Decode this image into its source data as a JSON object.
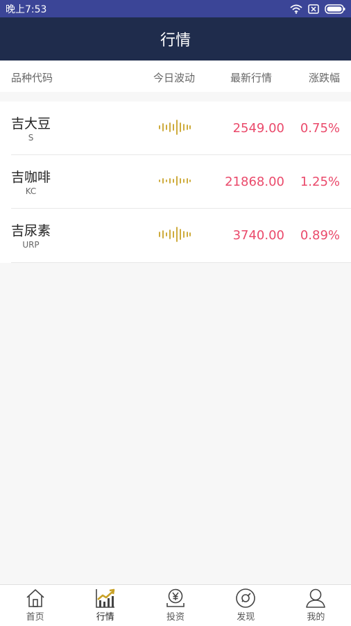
{
  "status_bar": {
    "time": "晚上7:53",
    "icons": [
      "wifi-icon",
      "sim-icon",
      "battery-icon"
    ]
  },
  "header": {
    "title": "行情"
  },
  "columns": {
    "code": "品种代码",
    "wave": "今日波动",
    "price": "最新行情",
    "change": "涨跌幅"
  },
  "rows": [
    {
      "name": "吉大豆",
      "code": "S",
      "price": "2549.00",
      "change": "0.75%"
    },
    {
      "name": "吉咖啡",
      "code": "KC",
      "price": "21868.00",
      "change": "1.25%"
    },
    {
      "name": "吉尿素",
      "code": "URP",
      "price": "3740.00",
      "change": "0.89%"
    }
  ],
  "tabs": [
    {
      "label": "首页",
      "icon": "home-icon"
    },
    {
      "label": "行情",
      "icon": "chart-icon",
      "active": true
    },
    {
      "label": "投资",
      "icon": "yen-icon"
    },
    {
      "label": "发现",
      "icon": "compass-icon"
    },
    {
      "label": "我的",
      "icon": "user-icon"
    }
  ],
  "colors": {
    "status_bar": "#3b4597",
    "nav_bar": "#1f2c4c",
    "price_up": "#ea4a6b",
    "wave": "#c9a227",
    "active_tab": "#c9a227"
  }
}
